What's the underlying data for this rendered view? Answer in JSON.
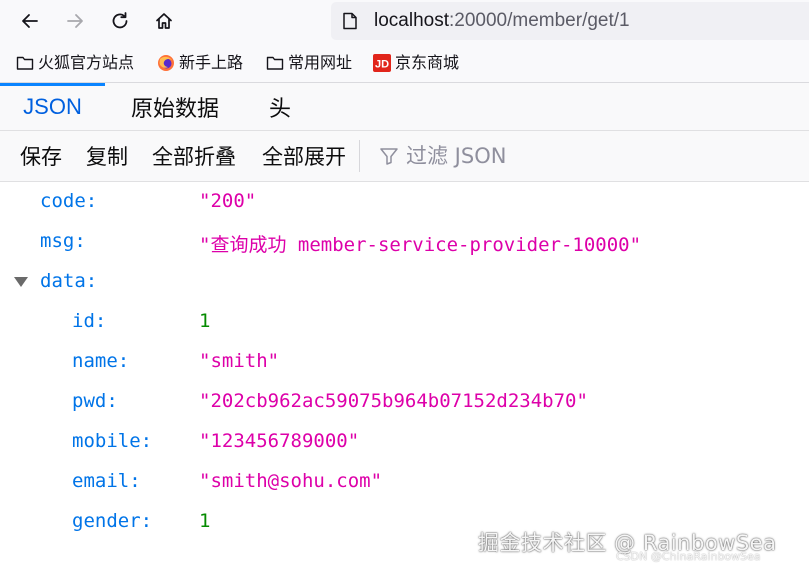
{
  "browser": {
    "url_host": "localhost",
    "url_path": ":20000/member/get/1"
  },
  "bookmarks": [
    {
      "label": "火狐官方站点",
      "icon": "folder-icon"
    },
    {
      "label": "新手上路",
      "icon": "firefox-icon"
    },
    {
      "label": "常用网址",
      "icon": "folder-icon"
    },
    {
      "label": "京东商城",
      "icon": "jd-logo-icon"
    }
  ],
  "viewer_tabs": [
    {
      "label": "JSON",
      "active": true
    },
    {
      "label": "原始数据",
      "active": false
    },
    {
      "label": "头",
      "active": false
    }
  ],
  "toolbar": {
    "save": "保存",
    "copy": "复制",
    "collapse_all": "全部折叠",
    "expand_all": "全部展开",
    "filter_placeholder": "过滤 JSON"
  },
  "json": {
    "code": {
      "key": "code:",
      "value": "\"200\""
    },
    "msg": {
      "key": "msg:",
      "value": "\"查询成功 member-service-provider-10000\""
    },
    "data": {
      "key": "data:",
      "id": {
        "key": "id:",
        "value": "1"
      },
      "name": {
        "key": "name:",
        "value": "\"smith\""
      },
      "pwd": {
        "key": "pwd:",
        "value": "\"202cb962ac59075b964b07152d234b70\""
      },
      "mobile": {
        "key": "mobile:",
        "value": "\"123456789000\""
      },
      "email": {
        "key": "email:",
        "value": "\"smith@sohu.com\""
      },
      "gender": {
        "key": "gender:",
        "value": "1"
      }
    }
  },
  "watermark": {
    "main": "掘金技术社区 @ RainbowSea",
    "sub": "CSDN @ChinaRainbowSea"
  },
  "colors": {
    "json_key": "#0074e8",
    "json_string": "#dd00a9",
    "json_number": "#058b00",
    "active_tab": "#0060df"
  }
}
